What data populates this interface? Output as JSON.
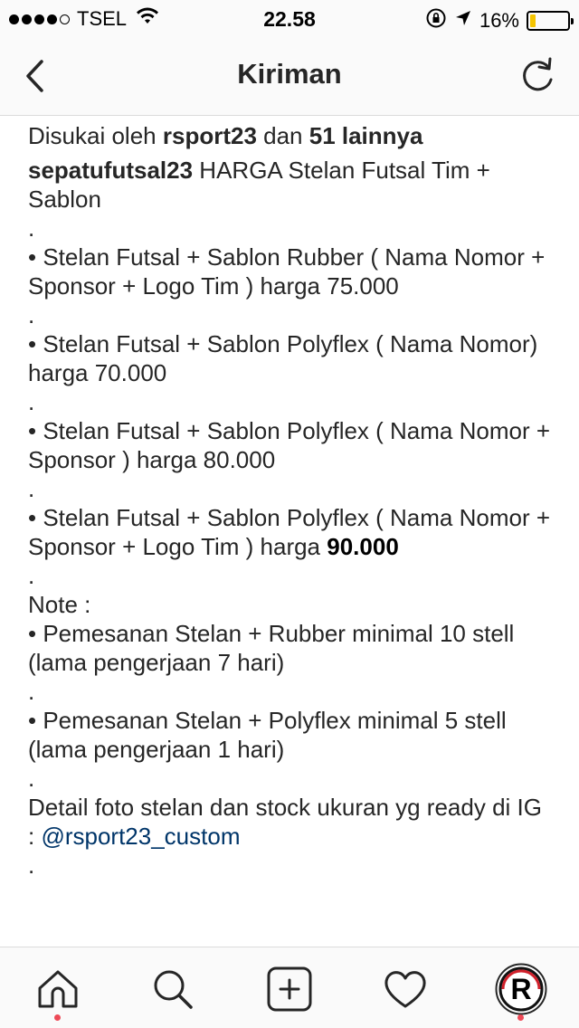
{
  "status_bar": {
    "carrier": "TSEL",
    "time": "22.58",
    "battery_percent": "16%",
    "battery_level": 0.16,
    "icons": [
      "signal-dots-icon",
      "wifi-icon",
      "orientation-lock-icon",
      "location-arrow-icon",
      "battery-icon"
    ]
  },
  "header": {
    "title": "Kiriman",
    "back_icon": "back-chevron-icon",
    "refresh_icon": "refresh-icon"
  },
  "post": {
    "likes_prefix": "Disukai oleh ",
    "likes_user": "rsport23",
    "likes_mid": " dan ",
    "likes_count": "51 lainnya",
    "caption_user": "sepatufutsal23",
    "caption_head": " HARGA Stelan Futsal Tim + Sablon\n.\n• Stelan Futsal + Sablon Rubber ( Nama Nomor + Sponsor + Logo Tim ) harga 75.000\n.\n• Stelan Futsal + Sablon Polyflex ( Nama Nomor) harga 70.000\n.\n• Stelan Futsal + Sablon Polyflex ( Nama Nomor + Sponsor ) harga 80.000\n.\n• Stelan Futsal + Sablon Polyflex ( Nama Nomor + Sponsor + Logo Tim ) harga ",
    "caption_price_bold": "90.000",
    "caption_tail": "\n.\nNote :\n• Pemesanan Stelan + Rubber minimal 10 stell (lama pengerjaan 7 hari)\n.\n• Pemesanan Stelan + Polyflex minimal 5 stell (lama pengerjaan 1 hari)\n.\nDetail foto stelan dan stock ukuran yg ready di IG : ",
    "caption_mention": "@rsport23_custom",
    "caption_end": "\n."
  },
  "tabbar": {
    "items": [
      "home-icon",
      "search-icon",
      "add-post-icon",
      "activity-heart-icon",
      "profile-avatar-icon"
    ],
    "accent": "#ed4956"
  },
  "colors": {
    "text": "#262626",
    "mention": "#003569",
    "battery": "#f4c400"
  }
}
